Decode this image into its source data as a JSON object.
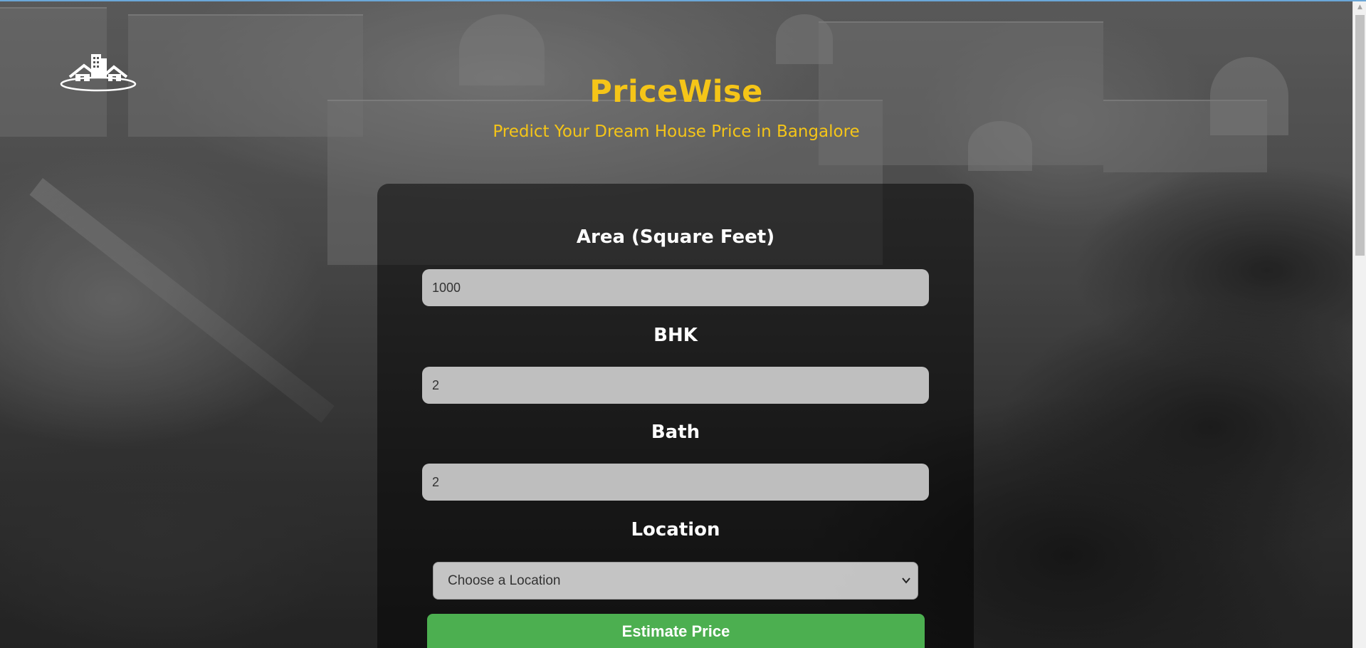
{
  "app": {
    "title": "PriceWise",
    "subtitle": "Predict Your Dream House Price in Bangalore",
    "logo_icon": "house-building-logo-icon"
  },
  "colors": {
    "accent": "#f5c518",
    "button": "#4caf50",
    "card": "rgba(0,0,0,0.5)"
  },
  "form": {
    "area": {
      "label": "Area (Square Feet)",
      "value": "1000"
    },
    "bhk": {
      "label": "BHK",
      "value": "2"
    },
    "bath": {
      "label": "Bath",
      "value": "2"
    },
    "location": {
      "label": "Location",
      "selected": "Choose a Location",
      "icon": "chevron-down-icon"
    },
    "submit_label": "Estimate Price"
  }
}
